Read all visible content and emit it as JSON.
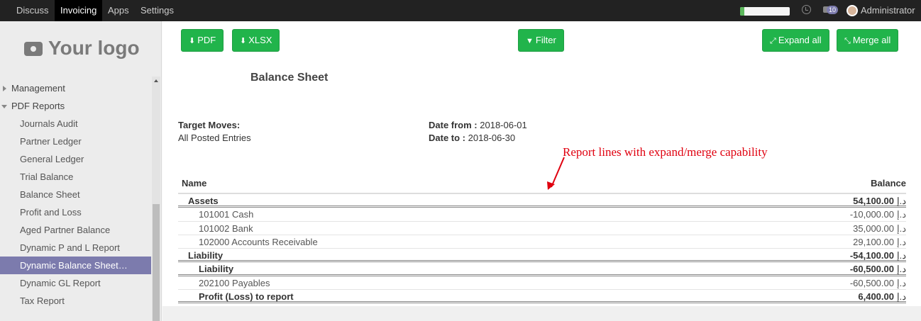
{
  "navbar": {
    "items": [
      "Discuss",
      "Invoicing",
      "Apps",
      "Settings"
    ],
    "active": "Invoicing",
    "progress_fraction": 0.08,
    "badge": "10",
    "user": "Administrator"
  },
  "sidebar": {
    "logo_text": "Your logo",
    "items": [
      {
        "label": "Management",
        "type": "group",
        "caret": "right"
      },
      {
        "label": "PDF Reports",
        "type": "group",
        "caret": "down"
      },
      {
        "label": "Journals Audit"
      },
      {
        "label": "Partner Ledger"
      },
      {
        "label": "General Ledger"
      },
      {
        "label": "Trial Balance"
      },
      {
        "label": "Balance Sheet"
      },
      {
        "label": "Profit and Loss"
      },
      {
        "label": "Aged Partner Balance"
      },
      {
        "label": "Dynamic P and L Report"
      },
      {
        "label": "Dynamic Balance Sheet…",
        "active": true
      },
      {
        "label": "Dynamic GL Report"
      },
      {
        "label": "Tax Report"
      }
    ]
  },
  "toolbar": {
    "pdf": "PDF",
    "xlsx": "XLSX",
    "filter": "Filter",
    "expand": "Expand all",
    "merge": "Merge all"
  },
  "report": {
    "title": "Balance Sheet",
    "target_moves_label": "Target Moves:",
    "target_moves_value": "All Posted Entries",
    "date_from_label": "Date from :",
    "date_from_value": "2018-06-01",
    "date_to_label": "Date to :",
    "date_to_value": "2018-06-30",
    "annotation": "Report lines with expand/merge capability",
    "col_name": "Name",
    "col_balance": "Balance",
    "currency": "د.إ",
    "rows": [
      {
        "name": "Assets",
        "balance": "54,100.00",
        "level": 0,
        "bold": true
      },
      {
        "name": "101001 Cash",
        "balance": "-10,000.00",
        "level": 1,
        "bold": false
      },
      {
        "name": "101002 Bank",
        "balance": "35,000.00",
        "level": 1,
        "bold": false
      },
      {
        "name": "102000 Accounts Receivable",
        "balance": "29,100.00",
        "level": 1,
        "bold": false
      },
      {
        "name": "Liability",
        "balance": "-54,100.00",
        "level": 0,
        "bold": true
      },
      {
        "name": "Liability",
        "balance": "-60,500.00",
        "level": 1,
        "bold": true
      },
      {
        "name": "202100 Payables",
        "balance": "-60,500.00",
        "level": 1,
        "bold": false
      },
      {
        "name": "Profit (Loss) to report",
        "balance": "6,400.00",
        "level": 1,
        "bold": true
      }
    ]
  },
  "colors": {
    "accent": "#7c7bad",
    "button": "#21b44b",
    "annotation": "#e0000f"
  }
}
